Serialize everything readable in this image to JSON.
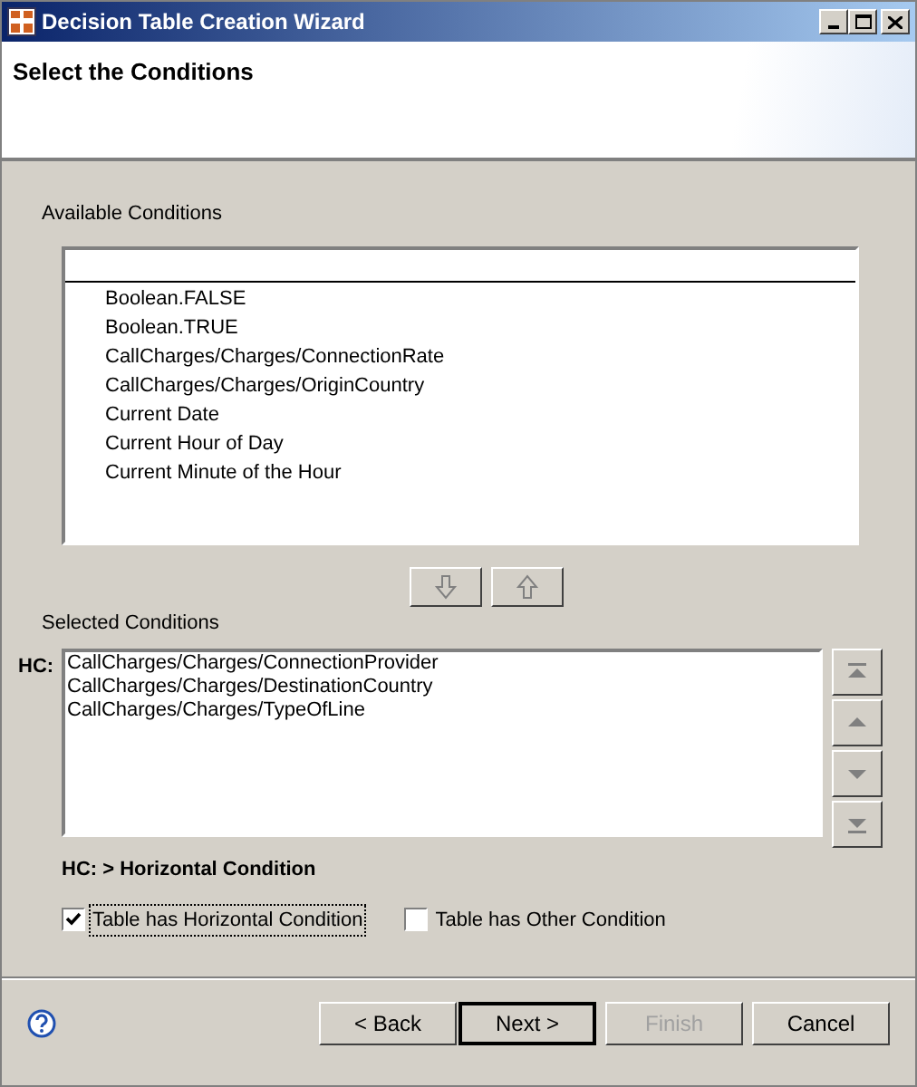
{
  "window": {
    "title": "Decision Table Creation Wizard"
  },
  "header": {
    "title": "Select the Conditions"
  },
  "available": {
    "label": "Available Conditions",
    "items": [
      "Boolean.FALSE",
      "Boolean.TRUE",
      "CallCharges/Charges/ConnectionRate",
      "CallCharges/Charges/OriginCountry",
      "Current Date",
      "Current Hour of Day",
      "Current Minute of the Hour"
    ]
  },
  "transfer_buttons": [
    {
      "kind": "down"
    },
    {
      "kind": "up"
    }
  ],
  "selected": {
    "label": "Selected Conditions",
    "prefix": "HC:",
    "items": [
      "CallCharges/Charges/ConnectionProvider",
      "CallCharges/Charges/DestinationCountry",
      "CallCharges/Charges/TypeOfLine"
    ]
  },
  "order_buttons": [
    {
      "kind": "top",
      "disabled": true
    },
    {
      "kind": "up",
      "disabled": true
    },
    {
      "kind": "down",
      "disabled": true
    },
    {
      "kind": "bottom",
      "disabled": true
    }
  ],
  "legend": "HC: > Horizontal Condition",
  "checkboxes": [
    {
      "label": "Table has Horizontal Condition",
      "checked": true,
      "focused": true
    },
    {
      "label": "Table has Other Condition",
      "checked": false,
      "focused": false
    }
  ],
  "buttons": [
    {
      "label": "< Back",
      "disabled": false,
      "default": false
    },
    {
      "label": "Next >",
      "disabled": false,
      "default": true
    },
    {
      "label": "Finish",
      "disabled": true,
      "default": false
    },
    {
      "label": "Cancel",
      "disabled": false,
      "default": false
    }
  ]
}
